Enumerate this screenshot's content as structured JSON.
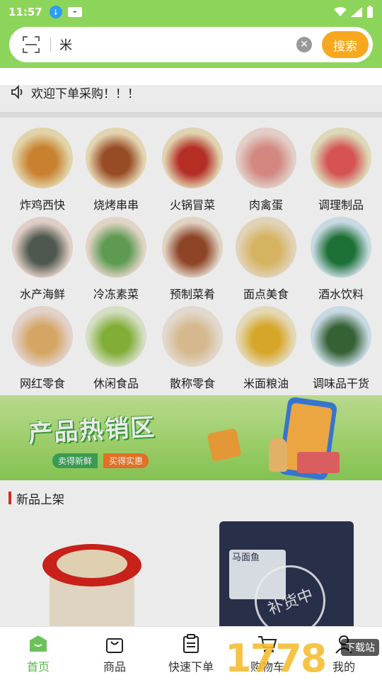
{
  "status_bar": {
    "time": "11:57"
  },
  "search": {
    "value": "米",
    "button_label": "搜索"
  },
  "notice": {
    "text": "欢迎下单采购！！！"
  },
  "categories": [
    {
      "label": "炸鸡西快",
      "colors": [
        "#f6e6b8",
        "#d98c32"
      ]
    },
    {
      "label": "烧烤串串",
      "colors": [
        "#f7e7bf",
        "#a5532a"
      ]
    },
    {
      "label": "火锅冒菜",
      "colors": [
        "#f4e5c0",
        "#c4322a"
      ]
    },
    {
      "label": "肉禽蛋",
      "colors": [
        "#f6e1d8",
        "#e4938b"
      ]
    },
    {
      "label": "调理制品",
      "colors": [
        "#f0ecc8",
        "#e85b5b"
      ]
    },
    {
      "label": "水产海鲜",
      "colors": [
        "#f3e0d7",
        "#556055"
      ]
    },
    {
      "label": "冷冻素菜",
      "colors": [
        "#f3e6d6",
        "#67a85a"
      ]
    },
    {
      "label": "预制菜肴",
      "colors": [
        "#f3e5d5",
        "#9b4a2a"
      ]
    },
    {
      "label": "面点美食",
      "colors": [
        "#f5e5c8",
        "#e8c36a"
      ]
    },
    {
      "label": "酒水饮料",
      "colors": [
        "#d8ecf6",
        "#1f7a3a"
      ]
    },
    {
      "label": "网红零食",
      "colors": [
        "#f6e4dc",
        "#e7b46c"
      ]
    },
    {
      "label": "休闲食品",
      "colors": [
        "#e8f1d6",
        "#8cbd3c"
      ]
    },
    {
      "label": "散称零食",
      "colors": [
        "#f6ece0",
        "#e8c89a"
      ]
    },
    {
      "label": "米面粮油",
      "colors": [
        "#f7ecc8",
        "#e9b52c"
      ]
    },
    {
      "label": "调味品干货",
      "colors": [
        "#d8ecf6",
        "#3b6a3a"
      ]
    }
  ],
  "banner": {
    "title": "产品热销区",
    "sub1": "卖得新鲜",
    "sub2": "买得实惠"
  },
  "new_section": {
    "title": "新品上架"
  },
  "products": [
    {
      "jar_text": ""
    },
    {
      "label": "马面鱼",
      "stamp": "补货中"
    }
  ],
  "bottom_nav": [
    {
      "label": "首页",
      "active": true
    },
    {
      "label": "商品",
      "active": false
    },
    {
      "label": "快速下单",
      "active": false
    },
    {
      "label": "购物车",
      "active": false
    },
    {
      "label": "我的",
      "active": false
    }
  ],
  "watermark": {
    "number": "1778",
    "tag": "下载站"
  },
  "colors": {
    "header": "#8cd55a",
    "search_button": "#f8a81e",
    "active_nav": "#54b64a"
  }
}
